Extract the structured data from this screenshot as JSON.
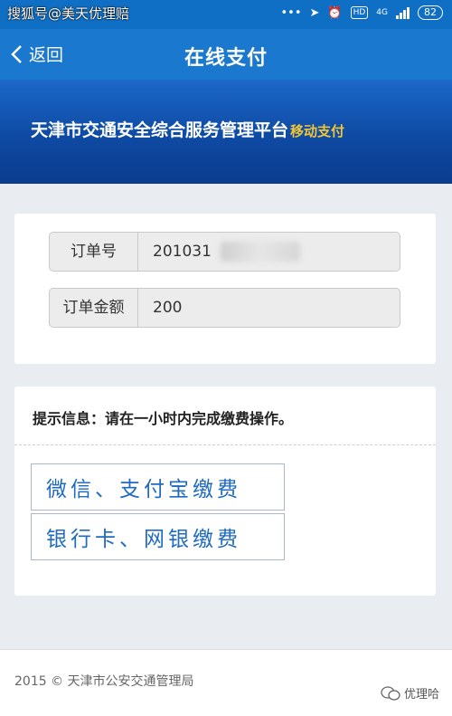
{
  "status_bar": {
    "watermark": "搜狐号@美天优理赔",
    "network": "4G",
    "hd": "HD",
    "battery": "82"
  },
  "nav": {
    "back_label": "返回",
    "title": "在线支付"
  },
  "banner": {
    "title": "天津市交通安全综合服务管理平台",
    "subtitle": "移动支付"
  },
  "order": {
    "number_label": "订单号",
    "number_value": "201031",
    "amount_label": "订单金额",
    "amount_value": "200"
  },
  "tip": "提示信息：请在一小时内完成缴费操作。",
  "payment_options": [
    {
      "label": "微信、支付宝缴费"
    },
    {
      "label": "银行卡、网银缴费"
    }
  ],
  "footer": {
    "copyright": "2015 © 天津市公安交通管理局",
    "watermark": "优理哈"
  },
  "colors": {
    "nav_blue": "#1b78cf",
    "banner_blue": "#0e4aa3",
    "accent_yellow": "#f3c633",
    "button_text": "#1f6bc0"
  }
}
